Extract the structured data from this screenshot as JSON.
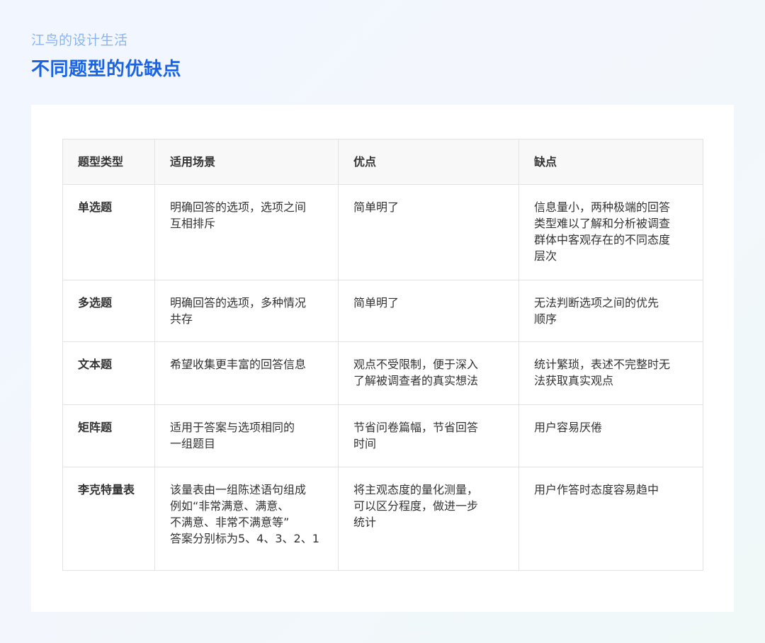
{
  "header": {
    "brand": "江鸟的设计生活",
    "title": "不同题型的优缺点"
  },
  "colors": {
    "accent": "#1a63e5",
    "brand_text": "#8ab4f4",
    "header_row_bg": "#f8f8f8",
    "border": "#e3e3e3",
    "text": "#333333"
  },
  "table": {
    "columns": [
      "题型类型",
      "适用场景",
      "优点",
      "缺点"
    ],
    "rows": [
      {
        "type": "单选题",
        "scenario": [
          "明确回答的选项，选项之间",
          "互相排斥"
        ],
        "pros": [
          "简单明了"
        ],
        "cons": [
          "信息量小，两种极端的回答",
          "类型难以了解和分析被调查",
          "群体中客观存在的不同态度",
          "层次"
        ]
      },
      {
        "type": "多选题",
        "scenario": [
          "明确回答的选项，多种情况",
          "共存"
        ],
        "pros": [
          "简单明了"
        ],
        "cons": [
          "无法判断选项之间的优先",
          "顺序"
        ]
      },
      {
        "type": "文本题",
        "scenario": [
          "希望收集更丰富的回答信息"
        ],
        "pros": [
          "观点不受限制，便于深入",
          "了解被调查者的真实想法"
        ],
        "cons": [
          "统计繁琐，表述不完整时无",
          "法获取真实观点"
        ]
      },
      {
        "type": "矩阵题",
        "scenario": [
          "适用于答案与选项相同的",
          "一组题目"
        ],
        "pros": [
          "节省问卷篇幅，节省回答",
          "时间"
        ],
        "cons": [
          "用户容易厌倦"
        ]
      },
      {
        "type": "李克特量表",
        "scenario": [
          "该量表由一组陈述语句组成",
          "例如“非常满意、满意、",
          "不满意、非常不满意等”",
          "答案分别标为5、4、3、2、1"
        ],
        "pros": [
          "将主观态度的量化测量，",
          "可以区分程度，做进一步",
          "统计"
        ],
        "cons": [
          "用户作答时态度容易趋中"
        ]
      }
    ]
  }
}
